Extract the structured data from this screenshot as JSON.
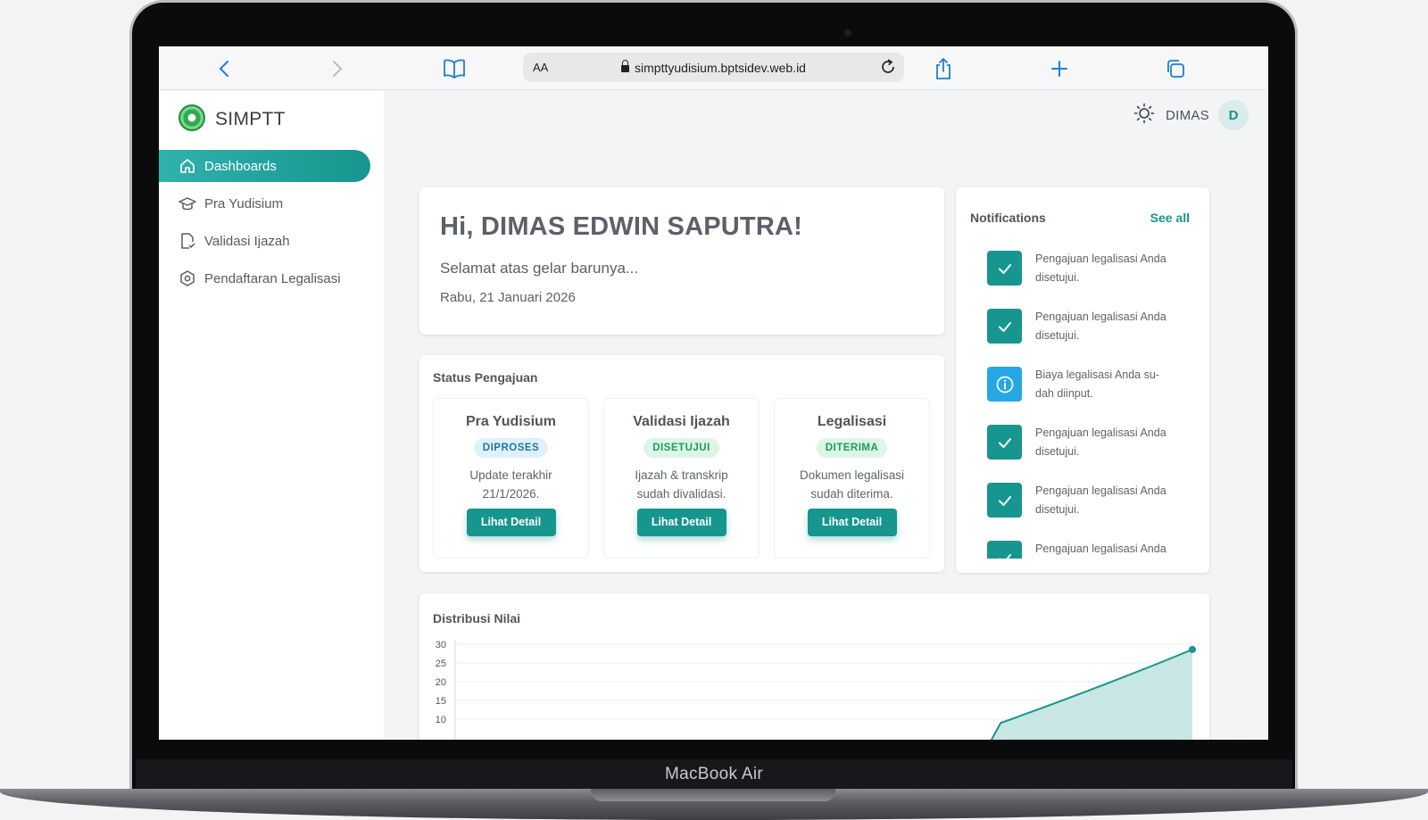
{
  "device": {
    "label": "MacBook Air"
  },
  "browser": {
    "text_size_label": "AA",
    "url": "simpttyudisium.bptsidev.web.id"
  },
  "sidebar": {
    "app_name": "SIMPTT",
    "items": [
      {
        "label": "Dashboards",
        "icon": "home-icon",
        "active": true
      },
      {
        "label": "Pra Yudisium",
        "icon": "graduation-cap-icon"
      },
      {
        "label": "Validasi Ijazah",
        "icon": "document-check-icon"
      },
      {
        "label": "Pendaftaran Legalisasi",
        "icon": "hexagon-icon"
      }
    ]
  },
  "header": {
    "user_name": "DIMAS",
    "avatar_initial": "D",
    "theme_icon": "sun-icon"
  },
  "welcome": {
    "title": "Hi, DIMAS EDWIN SAPUTRA!",
    "subtitle": "Selamat atas gelar barunya...",
    "date": "Rabu, 21 Januari 2026"
  },
  "status": {
    "title": "Status Pengajuan",
    "cards": [
      {
        "title": "Pra Yudisium",
        "badge": "DIPROSES",
        "badge_bg": "#dff1f8",
        "badge_fg": "#2076a3",
        "line1": "Update terakhir",
        "line2": "21/1/2026.",
        "button": "Lihat Detail"
      },
      {
        "title": "Validasi Ijazah",
        "badge": "DISETUJUI",
        "badge_bg": "#dcf5e6",
        "badge_fg": "#1f9c58",
        "line1": "Ijazah & transkrip",
        "line2": "sudah divalidasi.",
        "button": "Lihat Detail"
      },
      {
        "title": "Legalisasi",
        "badge": "DITERIMA",
        "badge_bg": "#dcf5e6",
        "badge_fg": "#1f9c58",
        "line1": "Dokumen legalisasi",
        "line2": "sudah diterima.",
        "button": "Lihat Detail"
      }
    ]
  },
  "notifications": {
    "title": "Notifications",
    "see_all": "See all",
    "items": [
      {
        "type": "success",
        "icon": "check-icon",
        "line1": "Pengajuan legalisasi Anda",
        "line2": "disetujui."
      },
      {
        "type": "success",
        "icon": "check-icon",
        "line1": "Pengajuan legalisasi Anda",
        "line2": "disetujui."
      },
      {
        "type": "info",
        "icon": "info-icon",
        "line1": "Biaya legalisasi Anda su-",
        "line2": "dah diinput."
      },
      {
        "type": "success",
        "icon": "check-icon",
        "line1": "Pengajuan legalisasi Anda",
        "line2": "disetujui."
      },
      {
        "type": "success",
        "icon": "check-icon",
        "line1": "Pengajuan legalisasi Anda",
        "line2": "disetujui."
      },
      {
        "type": "success",
        "icon": "check-icon",
        "line1": "Pengajuan legalisasi Anda",
        "line2": ""
      }
    ],
    "colors": {
      "success": "#17958f",
      "info": "#25a7e6"
    }
  },
  "distribution": {
    "title": "Distribusi Nilai",
    "chart_data": {
      "type": "area",
      "y_ticks": [
        30,
        25,
        20,
        15,
        10
      ],
      "ylim": [
        10,
        30
      ],
      "points": [
        {
          "x": 0.0,
          "y": 0
        },
        {
          "x": 0.74,
          "y": 9
        },
        {
          "x": 1.0,
          "y": 28.6
        }
      ],
      "color": "#17958f",
      "fill": "#c7e6e4",
      "grid": true
    }
  }
}
